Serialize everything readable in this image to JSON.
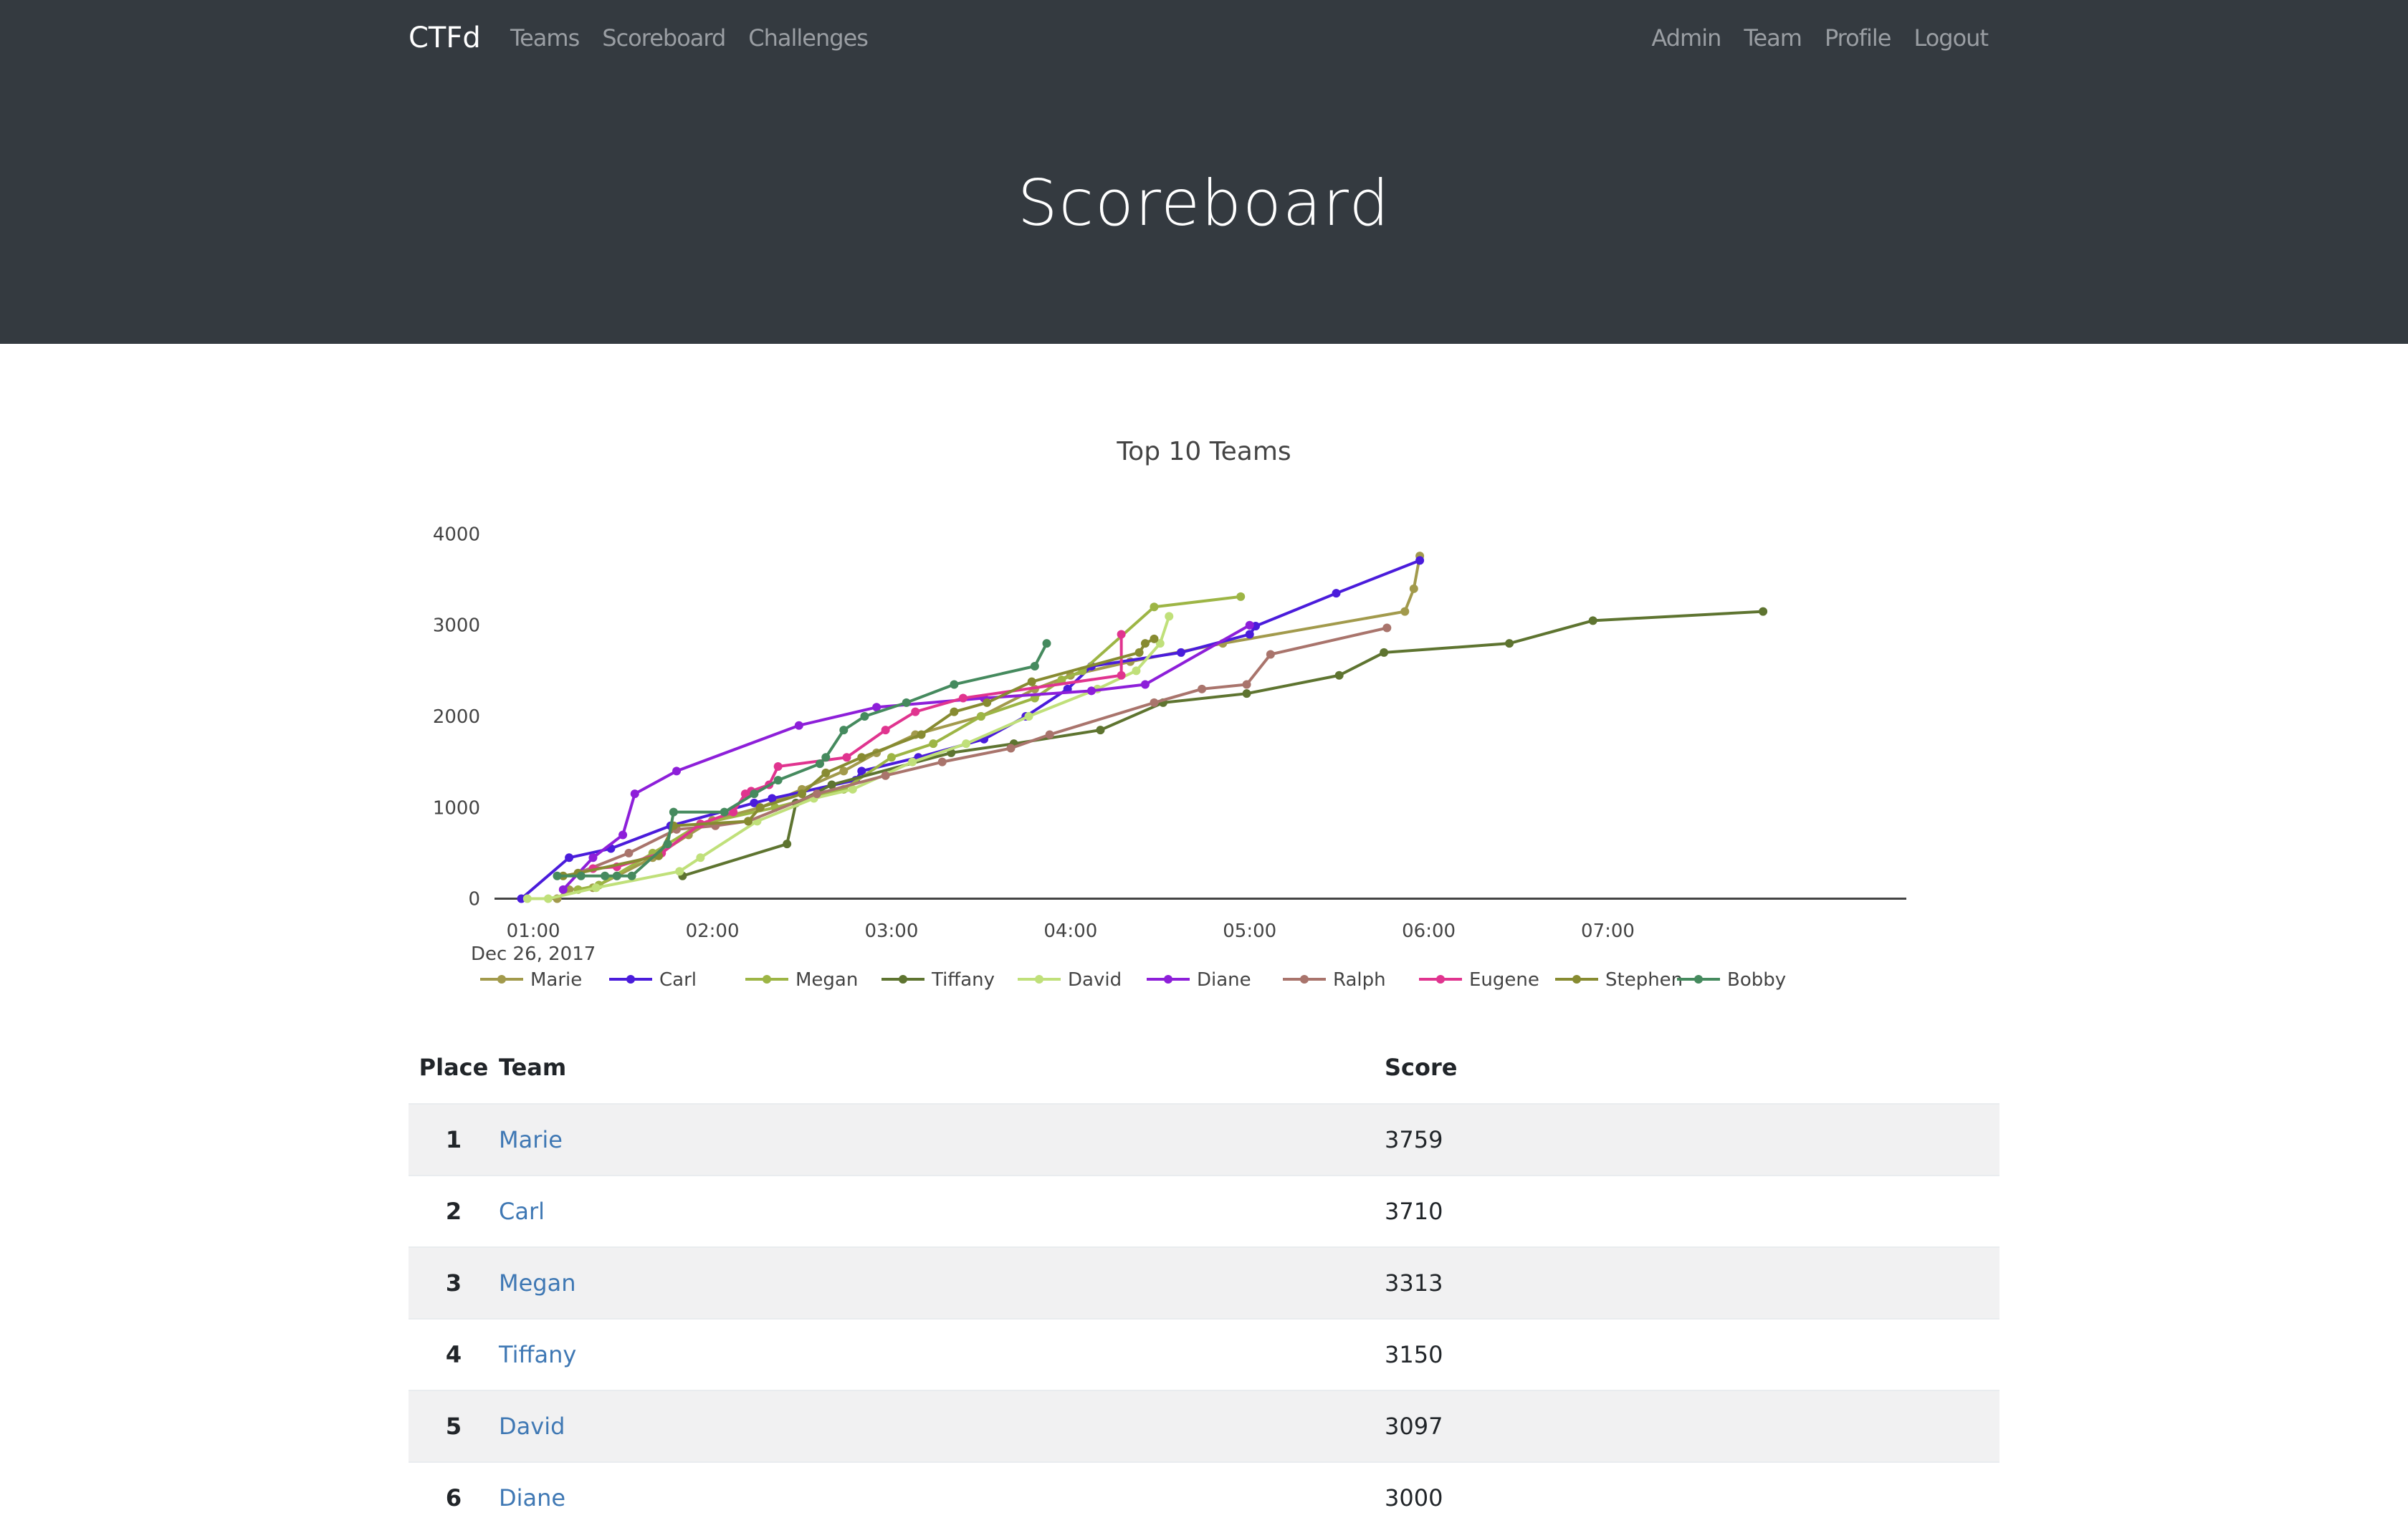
{
  "nav": {
    "brand": "CTFd",
    "left": [
      "Teams",
      "Scoreboard",
      "Challenges"
    ],
    "right": [
      "Admin",
      "Team",
      "Profile",
      "Logout"
    ]
  },
  "page": {
    "title": "Scoreboard"
  },
  "table": {
    "headers": {
      "place": "Place",
      "team": "Team",
      "score": "Score"
    },
    "rows": [
      {
        "place": "1",
        "team": "Marie",
        "score": "3759"
      },
      {
        "place": "2",
        "team": "Carl",
        "score": "3710"
      },
      {
        "place": "3",
        "team": "Megan",
        "score": "3313"
      },
      {
        "place": "4",
        "team": "Tiffany",
        "score": "3150"
      },
      {
        "place": "5",
        "team": "David",
        "score": "3097"
      },
      {
        "place": "6",
        "team": "Diane",
        "score": "3000"
      }
    ]
  },
  "chart_data": {
    "type": "line",
    "title": "Top 10 Teams",
    "xlabel": "",
    "ylabel": "",
    "x_units": "minutes after 00:00, Dec 26, 2017",
    "xlim": [
      47,
      520
    ],
    "ylim": [
      -200,
      4200
    ],
    "x_ticks": [
      {
        "value": 60,
        "label": "01:00",
        "sublabel": "Dec 26, 2017"
      },
      {
        "value": 120,
        "label": "02:00"
      },
      {
        "value": 180,
        "label": "03:00"
      },
      {
        "value": 240,
        "label": "04:00"
      },
      {
        "value": 300,
        "label": "05:00"
      },
      {
        "value": 360,
        "label": "06:00"
      },
      {
        "value": 420,
        "label": "07:00"
      }
    ],
    "y_ticks": [
      0,
      1000,
      2000,
      3000,
      4000
    ],
    "grid": false,
    "legend": "bottom",
    "series": [
      {
        "name": "Marie",
        "color": "#a29a4c",
        "x": [
          68,
          72,
          80,
          88,
          100,
          112,
          120,
          136,
          150,
          164,
          175,
          188,
          210,
          228,
          240,
          260,
          291,
          352,
          355,
          357
        ],
        "y": [
          0,
          100,
          120,
          250,
          450,
          700,
          860,
          1000,
          1200,
          1400,
          1600,
          1800,
          2000,
          2300,
          2450,
          2600,
          2800,
          3150,
          3400,
          3759
        ]
      },
      {
        "name": "Carl",
        "color": "#4a1cdb",
        "x": [
          56,
          72,
          86,
          106,
          134,
          140,
          168,
          170,
          189,
          211,
          225,
          239,
          247,
          277,
          300,
          302,
          329,
          357
        ],
        "y": [
          0,
          450,
          550,
          800,
          1050,
          1100,
          1300,
          1400,
          1550,
          1750,
          2000,
          2300,
          2550,
          2700,
          2900,
          2990,
          3350,
          3710
        ]
      },
      {
        "name": "Megan",
        "color": "#9db545",
        "x": [
          75,
          82,
          100,
          116,
          141,
          164,
          180,
          194,
          210,
          228,
          237,
          244,
          268,
          297
        ],
        "y": [
          100,
          150,
          500,
          820,
          1000,
          1200,
          1550,
          1700,
          2000,
          2200,
          2400,
          2500,
          3200,
          3313
        ]
      },
      {
        "name": "Tiffany",
        "color": "#5e7430",
        "x": [
          110,
          145,
          148,
          160,
          200,
          221,
          250,
          271,
          299,
          330,
          345,
          387,
          415,
          472
        ],
        "y": [
          250,
          600,
          1050,
          1250,
          1600,
          1700,
          1850,
          2150,
          2250,
          2450,
          2700,
          2800,
          3050,
          3150
        ]
      },
      {
        "name": "David",
        "color": "#c0e07a",
        "x": [
          58,
          65,
          81,
          109,
          116,
          135,
          154,
          167,
          187,
          205,
          226,
          249,
          262,
          270,
          273
        ],
        "y": [
          0,
          0,
          120,
          300,
          450,
          850,
          1100,
          1200,
          1500,
          1700,
          2000,
          2300,
          2500,
          2800,
          3097
        ]
      },
      {
        "name": "Diane",
        "color": "#8d1fd9",
        "x": [
          70,
          80,
          90,
          94,
          108,
          149,
          175,
          211,
          247,
          265,
          300
        ],
        "y": [
          100,
          450,
          700,
          1150,
          1400,
          1900,
          2100,
          2200,
          2280,
          2350,
          3000
        ]
      },
      {
        "name": "Ralph",
        "color": "#a9746c",
        "x": [
          75,
          92,
          108,
          121,
          132,
          155,
          178,
          197,
          220,
          233,
          268,
          284,
          299,
          307,
          346
        ],
        "y": [
          280,
          500,
          760,
          800,
          850,
          1150,
          1350,
          1500,
          1650,
          1800,
          2150,
          2300,
          2350,
          2680,
          2970
        ]
      },
      {
        "name": "Eugene",
        "color": "#e0348f",
        "x": [
          80,
          88,
          103,
          116,
          127,
          131,
          133,
          139,
          142,
          165,
          178,
          188,
          204,
          257,
          257
        ],
        "y": [
          330,
          350,
          500,
          820,
          950,
          1150,
          1180,
          1250,
          1450,
          1550,
          1850,
          2050,
          2200,
          2450,
          2900
        ]
      },
      {
        "name": "Stephen",
        "color": "#878b31",
        "x": [
          70,
          75,
          102,
          107,
          132,
          136,
          150,
          158,
          170,
          190,
          201,
          212,
          227,
          263,
          265,
          268
        ],
        "y": [
          250,
          280,
          470,
          800,
          850,
          1000,
          1150,
          1380,
          1550,
          1800,
          2050,
          2150,
          2380,
          2700,
          2800,
          2850
        ]
      },
      {
        "name": "Bobby",
        "color": "#458a5e",
        "x": [
          68,
          76,
          84,
          88,
          93,
          105,
          107,
          124,
          134,
          142,
          156,
          158,
          164,
          171,
          185,
          201,
          228,
          232
        ],
        "y": [
          250,
          250,
          250,
          250,
          250,
          600,
          950,
          950,
          1150,
          1300,
          1480,
          1550,
          1850,
          2000,
          2150,
          2350,
          2550,
          2800
        ]
      }
    ]
  }
}
